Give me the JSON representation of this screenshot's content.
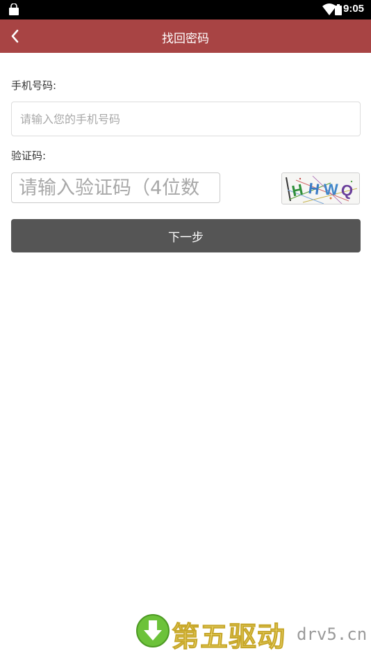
{
  "status_bar": {
    "time": "9:05",
    "icons": [
      "shopping-bag-icon",
      "wifi-icon",
      "battery-icon"
    ]
  },
  "header": {
    "title": "找回密码",
    "back_icon": "chevron-left-icon",
    "background": "#a84444"
  },
  "form": {
    "phone_label": "手机号码:",
    "phone_placeholder": "请输入您的手机号码",
    "code_label": "验证码:",
    "code_placeholder": "请输入验证码（4位数",
    "captcha_text": "HHWQ",
    "next_button": "下一步",
    "button_color": "#555555"
  },
  "watermark": {
    "icon": "download-arrow-icon",
    "text_cn": "第五驱动",
    "text_en": "drv5.cn"
  }
}
